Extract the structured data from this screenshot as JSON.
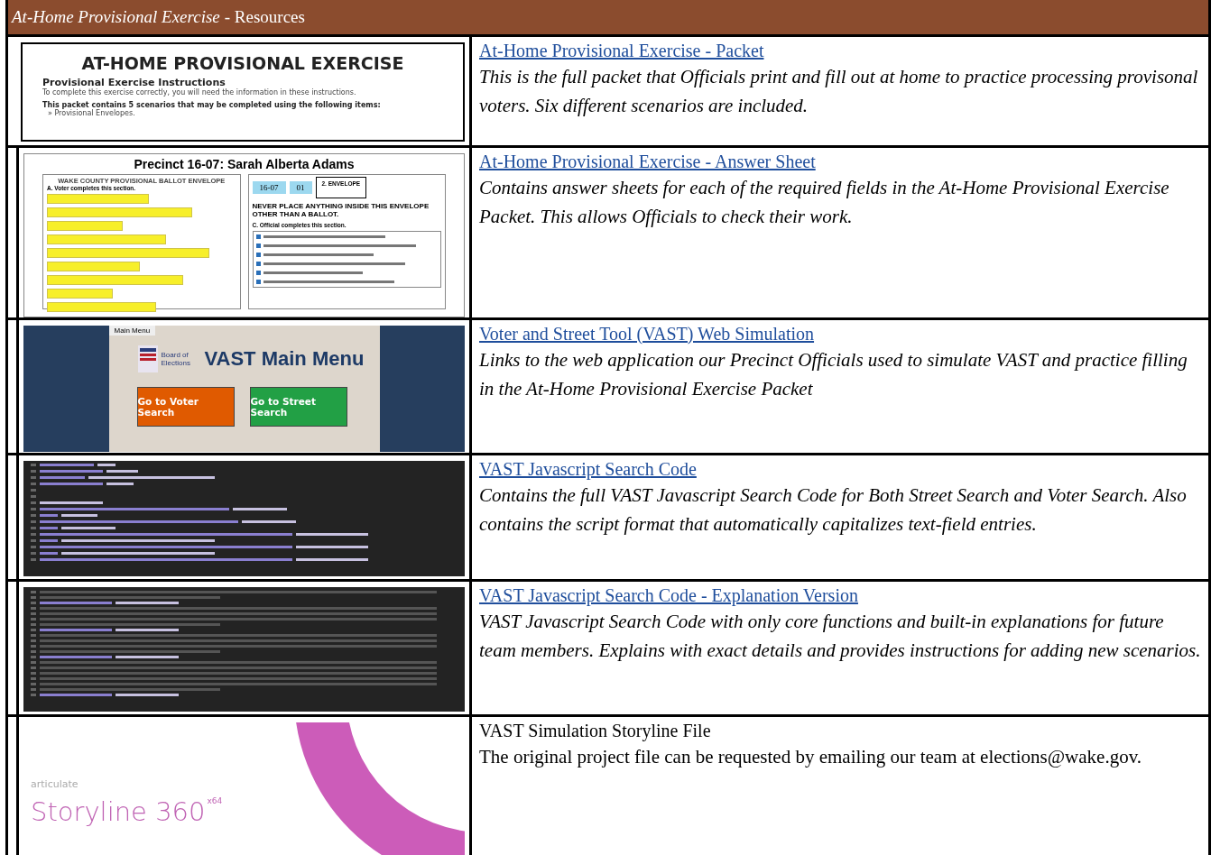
{
  "header": {
    "title": "At-Home Provisional Exercise",
    "suffix": "- Resources"
  },
  "rows": [
    {
      "kind": "link",
      "title": "At-Home Provisional Exercise - Packet",
      "description": "This is the full packet that Officials print and fill out at home to practice processing provisonal voters. Six different scenarios are included.",
      "thumbnail": {
        "kind": "packet",
        "heading": "AT-HOME PROVISIONAL EXERCISE",
        "subheading": "Provisional Exercise Instructions",
        "intro": "To complete this exercise correctly, you will need the information in these instructions.",
        "lead": "This packet contains 5 scenarios that may be completed using the following items:",
        "bullet": "» Provisional Envelopes."
      }
    },
    {
      "kind": "link",
      "title": "At-Home Provisional Exercise - Answer Sheet",
      "description": "Contains answer sheets for each of the required fields in the At-Home Provisional Exercise Packet. This allows Officials to check their work.",
      "thumbnail": {
        "kind": "answer",
        "heading": "Precinct 16-07: Sarah Alberta Adams",
        "form_title": "WAKE COUNTY PROVISIONAL BALLOT ENVELOPE",
        "section_a": "A. Voter completes this section.",
        "precinct": "16-07",
        "pollbook": "01",
        "envelope": "2. ENVELOPE",
        "warning": "NEVER PLACE ANYTHING INSIDE THIS ENVELOPE OTHER THAN A BALLOT.",
        "section_c": "C. Official completes this section."
      }
    },
    {
      "kind": "link",
      "title": "Voter and Street Tool (VAST) Web Simulation",
      "description": "Links to the web application our Precinct Officials used to simulate VAST and practice filling in the At-Home Provisional Exercise Packet",
      "thumbnail": {
        "kind": "menu",
        "tab": "Main Menu",
        "org": "Board of Elections",
        "heading": "VAST Main Menu",
        "buttons": [
          {
            "label": "Go to Voter Search",
            "color": "#e05a00"
          },
          {
            "label": "Go to Street Search",
            "color": "#22a045"
          }
        ]
      }
    },
    {
      "kind": "link",
      "title": "VAST Javascript Search Code",
      "description": "Contains the full VAST Javascript Search Code for Both Street Search and Voter Search. Also contains the script format that automatically capitalizes text-field entries.",
      "thumbnail": {
        "kind": "code"
      }
    },
    {
      "kind": "link",
      "title": "VAST Javascript Search Code - Explanation Version",
      "description": "VAST Javascript Search Code with only core functions and built-in explanations for future team members. Explains with exact details and provides instructions for adding new scenarios.",
      "thumbnail": {
        "kind": "code_doc"
      }
    },
    {
      "kind": "plain",
      "title": "VAST Simulation Storyline File",
      "description": "The original project file can be requested by emailing our team at elections@wake.gov.",
      "thumbnail": {
        "kind": "splash",
        "brand": "articulate",
        "product": "Storyline 360",
        "edition": "x64"
      }
    }
  ]
}
